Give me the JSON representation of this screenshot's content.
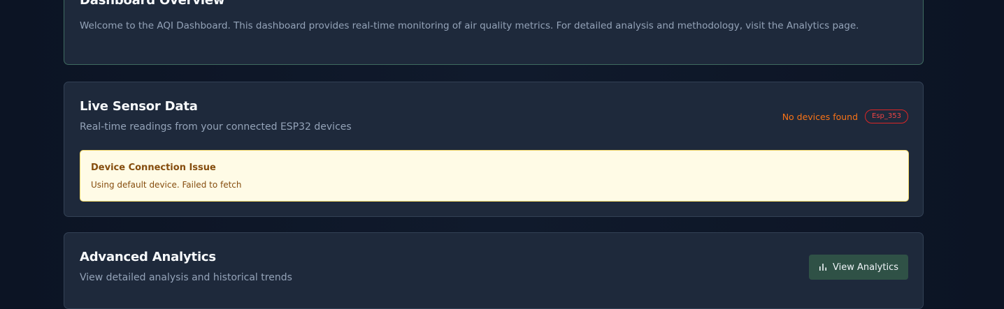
{
  "overview": {
    "title": "Dashboard Overview",
    "description": "Welcome to the AQI Dashboard. This dashboard provides real-time monitoring of air quality metrics. For detailed analysis and methodology, visit the Analytics page."
  },
  "sensor": {
    "title": "Live Sensor Data",
    "description": "Real-time readings from your connected ESP32 devices",
    "status_text": "No devices found",
    "device_badge": "Esp_353",
    "alert": {
      "title": "Device Connection Issue",
      "message": "Using default device. Failed to fetch"
    }
  },
  "analytics": {
    "title": "Advanced Analytics",
    "description": "View detailed analysis and historical trends",
    "button_label": "View Analytics",
    "button_icon": "bar-chart-icon"
  },
  "colors": {
    "page_background": "#101a2c",
    "card_background": "#1e293b",
    "status_warning": "#f97316",
    "badge_error": "#ef4444",
    "alert_background": "#fffbe6",
    "alert_text": "#854d0e",
    "button_background": "#2f5146"
  }
}
